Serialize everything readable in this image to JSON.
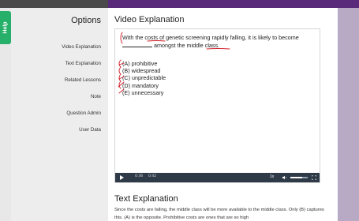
{
  "help_tab": {
    "label": "Help"
  },
  "sidebar": {
    "title": "Options",
    "items": [
      {
        "label": "Video Explanation"
      },
      {
        "label": "Text Explanation"
      },
      {
        "label": "Related Lessons"
      },
      {
        "label": "Note"
      },
      {
        "label": "Question Admin"
      },
      {
        "label": "User Data"
      }
    ]
  },
  "video_section": {
    "title": "Video Explanation",
    "question": {
      "before_blank": "With the costs of genetic screening rapidly falling, it is likely to become",
      "after_blank": "amongst the middle class."
    },
    "choices": [
      {
        "label": "(A) prohibitive"
      },
      {
        "label": "(B) widespread"
      },
      {
        "label": "(C) unpredictable"
      },
      {
        "label": "(D) mandatory"
      },
      {
        "label": "(E) unnecessary"
      }
    ]
  },
  "player": {
    "current_time": "0:36",
    "duration": "0:42",
    "speed": "1x",
    "volume": 0.7
  },
  "text_section": {
    "title": "Text Explanation",
    "body": "Since the costs are falling, the middle class will be more available to the middle class. Only (B) captures this. (A) is the opposite. Prohibitive costs are ones that are so high"
  },
  "colors": {
    "top_bar": "#5a2a7a",
    "right_panel": "#b8a9c4",
    "help_tab": "#27b06a",
    "player_bar": "#2e3a47",
    "ink": "#d1202a"
  }
}
